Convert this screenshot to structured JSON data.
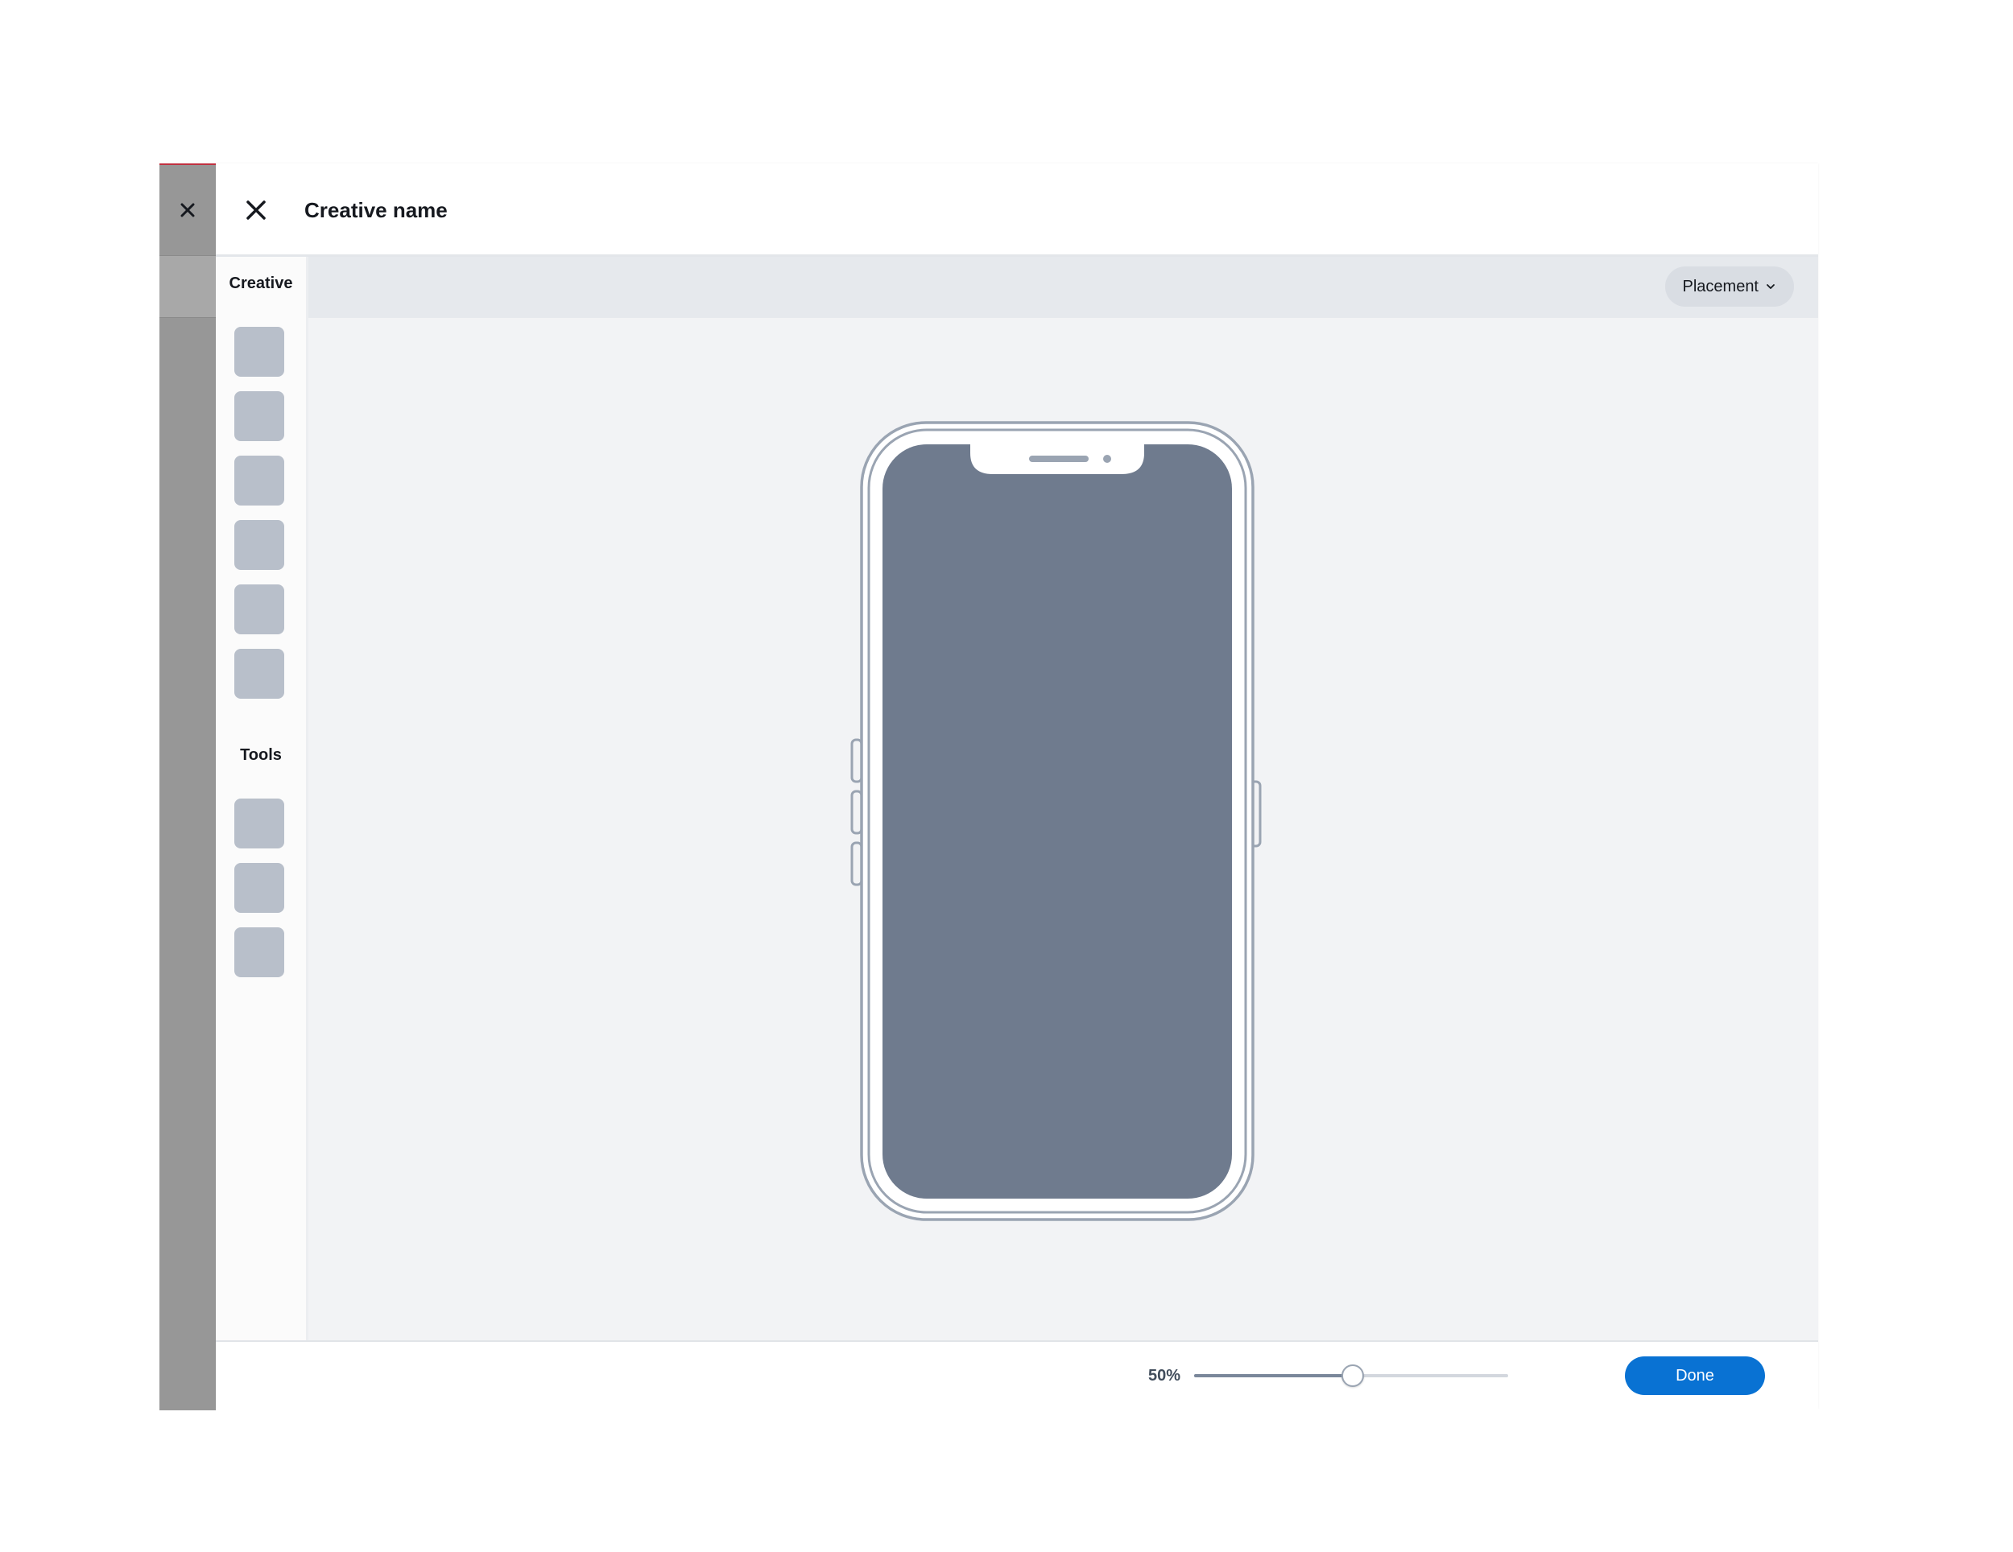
{
  "backdrop": {
    "close_icon": "close-icon"
  },
  "header": {
    "title": "Creative name",
    "close_icon": "close-icon"
  },
  "left_rail": {
    "sections": [
      {
        "heading": "Creative",
        "tile_count": 6
      },
      {
        "heading": "Tools",
        "tile_count": 3
      }
    ]
  },
  "toolbar": {
    "placement_label": "Placement",
    "placement_icon": "chevron-down-icon"
  },
  "footer": {
    "zoom_label": "50%",
    "zoom_percent": 50,
    "done_label": "Done"
  },
  "colors": {
    "primary": "#0972d3",
    "phone_screen": "#6f7b8e",
    "phone_outline": "#9aa4b2",
    "tile": "#b8bfca",
    "canvas_bg": "#f2f3f5"
  }
}
